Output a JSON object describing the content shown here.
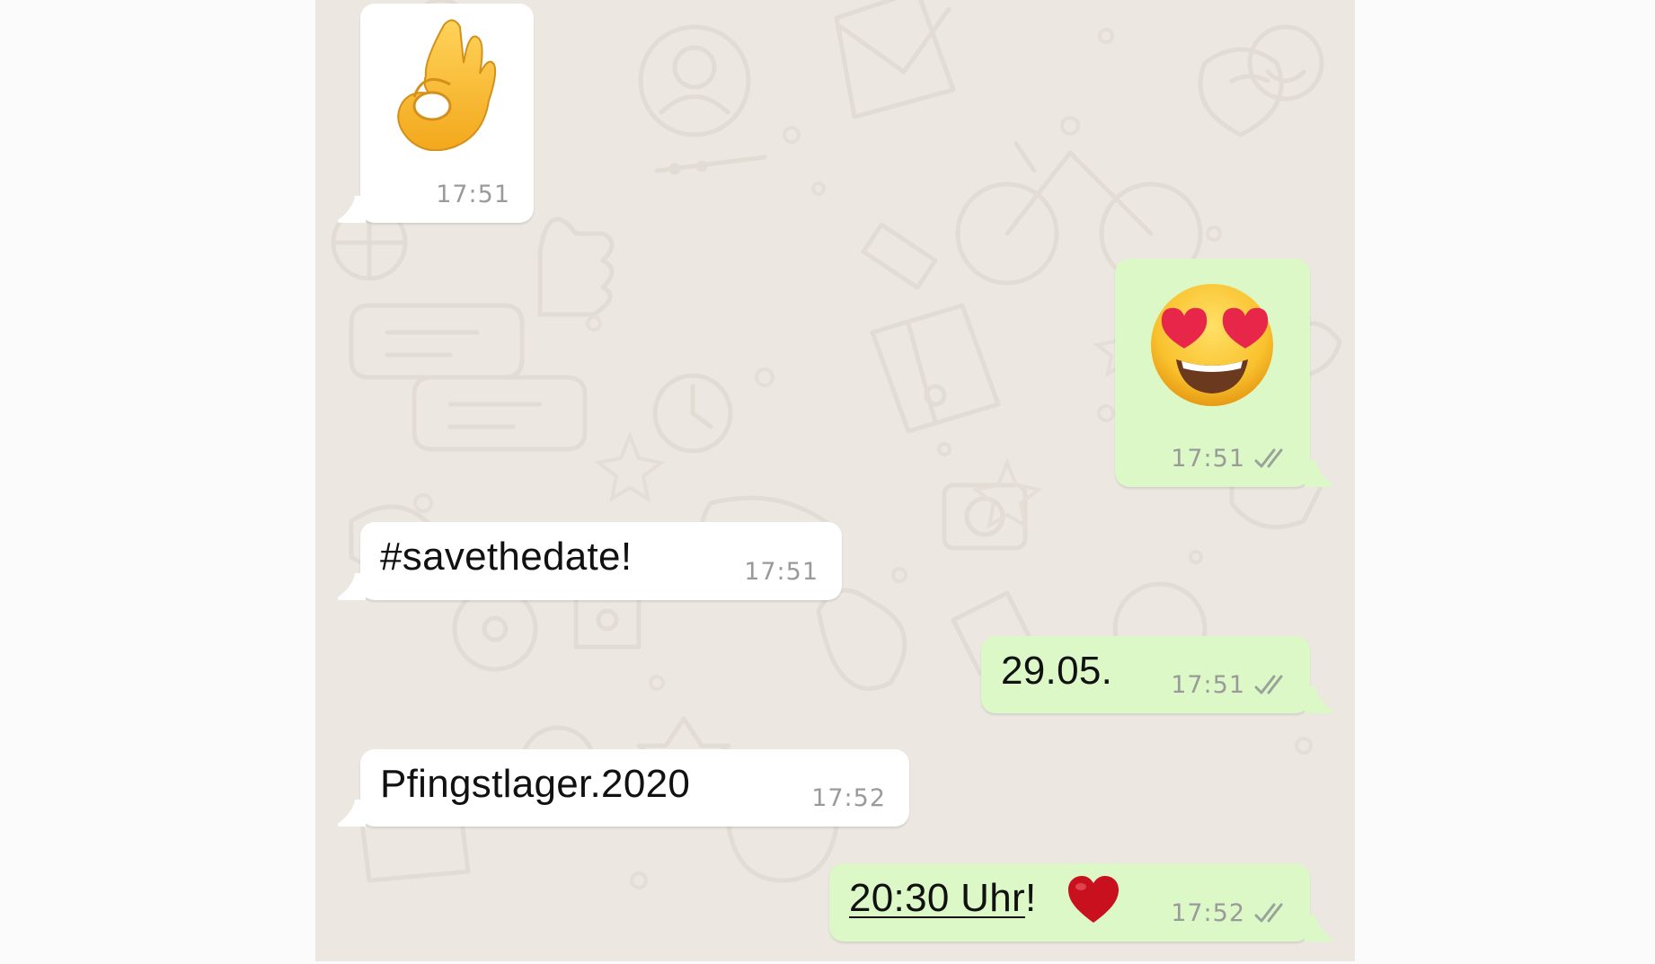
{
  "messages": [
    {
      "id": "m1",
      "direction": "incoming",
      "emoji": "ok-hand",
      "time": "17:51"
    },
    {
      "id": "m2",
      "direction": "outgoing",
      "emoji": "heart-eyes",
      "time": "17:51",
      "status": "read"
    },
    {
      "id": "m3",
      "direction": "incoming",
      "text": "#savethedate!",
      "time": "17:51"
    },
    {
      "id": "m4",
      "direction": "outgoing",
      "text": "29.05.",
      "time": "17:51",
      "status": "read"
    },
    {
      "id": "m5",
      "direction": "incoming",
      "text": "Pfingstlager.2020",
      "time": "17:52"
    },
    {
      "id": "m6",
      "direction": "outgoing",
      "text_link": "20:30 Uhr",
      "text_suffix": "!",
      "emoji": "red-heart",
      "time": "17:52",
      "status": "read"
    }
  ],
  "colors": {
    "wallpaper": "#ece7e1",
    "incoming_bubble": "#ffffff",
    "outgoing_bubble": "#dcf8c6",
    "timestamp": "#9a9a9a",
    "read_ticks": "#9aa39a"
  }
}
